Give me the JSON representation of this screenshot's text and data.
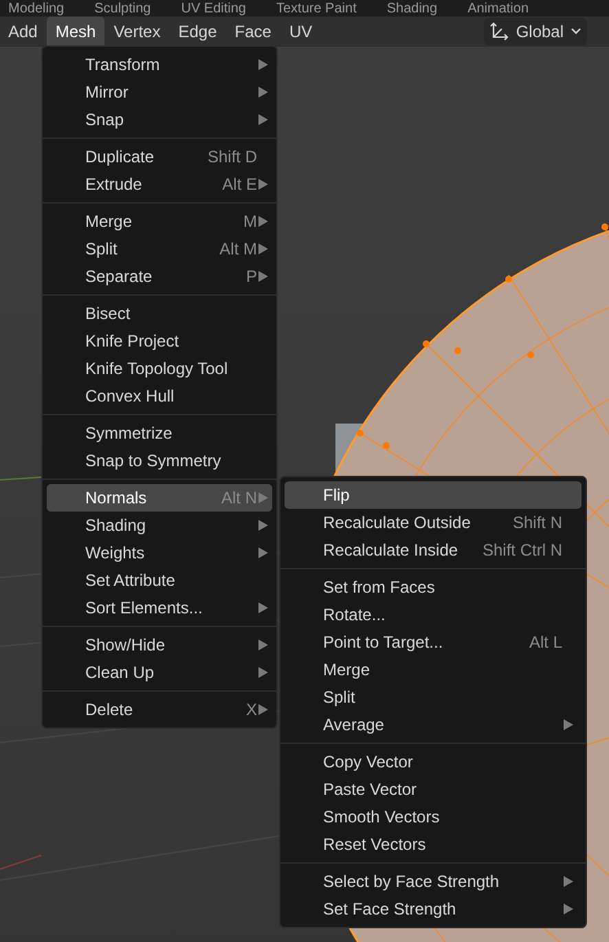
{
  "workspace_tabs": [
    "Modeling",
    "Sculpting",
    "UV Editing",
    "Texture Paint",
    "Shading",
    "Animation"
  ],
  "header_menus": [
    {
      "label": "Add",
      "selected": false
    },
    {
      "label": "Mesh",
      "selected": true
    },
    {
      "label": "Vertex",
      "selected": false
    },
    {
      "label": "Edge",
      "selected": false
    },
    {
      "label": "Face",
      "selected": false
    },
    {
      "label": "UV",
      "selected": false
    }
  ],
  "orientation_dropdown": {
    "value": "Global"
  },
  "mesh_menu": {
    "sections": [
      [
        {
          "label": "Transform",
          "submenu": true,
          "selected": false
        },
        {
          "label": "Mirror",
          "submenu": true,
          "selected": false
        },
        {
          "label": "Snap",
          "submenu": true,
          "selected": false
        }
      ],
      [
        {
          "label": "Duplicate",
          "shortcut": "Shift D",
          "submenu": false,
          "selected": false
        },
        {
          "label": "Extrude",
          "shortcut": "Alt E",
          "submenu": true,
          "selected": false
        }
      ],
      [
        {
          "label": "Merge",
          "shortcut": "M",
          "submenu": true,
          "selected": false
        },
        {
          "label": "Split",
          "shortcut": "Alt M",
          "submenu": true,
          "selected": false
        },
        {
          "label": "Separate",
          "shortcut": "P",
          "submenu": true,
          "selected": false
        }
      ],
      [
        {
          "label": "Bisect",
          "submenu": false,
          "selected": false
        },
        {
          "label": "Knife Project",
          "submenu": false,
          "selected": false
        },
        {
          "label": "Knife Topology Tool",
          "submenu": false,
          "selected": false
        },
        {
          "label": "Convex Hull",
          "submenu": false,
          "selected": false
        }
      ],
      [
        {
          "label": "Symmetrize",
          "submenu": false,
          "selected": false
        },
        {
          "label": "Snap to Symmetry",
          "submenu": false,
          "selected": false
        }
      ],
      [
        {
          "label": "Normals",
          "shortcut": "Alt N",
          "submenu": true,
          "selected": true
        },
        {
          "label": "Shading",
          "submenu": true,
          "selected": false
        },
        {
          "label": "Weights",
          "submenu": true,
          "selected": false
        },
        {
          "label": "Set Attribute",
          "submenu": false,
          "selected": false
        },
        {
          "label": "Sort Elements...",
          "submenu": true,
          "selected": false
        }
      ],
      [
        {
          "label": "Show/Hide",
          "submenu": true,
          "selected": false
        },
        {
          "label": "Clean Up",
          "submenu": true,
          "selected": false
        }
      ],
      [
        {
          "label": "Delete",
          "shortcut": "X",
          "submenu": true,
          "selected": false
        }
      ]
    ]
  },
  "normals_submenu": {
    "sections": [
      [
        {
          "label": "Flip",
          "submenu": false,
          "selected": true
        },
        {
          "label": "Recalculate Outside",
          "shortcut": "Shift N",
          "submenu": false,
          "selected": false
        },
        {
          "label": "Recalculate Inside",
          "shortcut": "Shift Ctrl N",
          "submenu": false,
          "selected": false
        }
      ],
      [
        {
          "label": "Set from Faces",
          "submenu": false,
          "selected": false
        },
        {
          "label": "Rotate...",
          "submenu": false,
          "selected": false
        },
        {
          "label": "Point to Target...",
          "shortcut": "Alt L",
          "submenu": false,
          "selected": false
        },
        {
          "label": "Merge",
          "submenu": false,
          "selected": false
        },
        {
          "label": "Split",
          "submenu": false,
          "selected": false
        },
        {
          "label": "Average",
          "submenu": true,
          "selected": false
        }
      ],
      [
        {
          "label": "Copy Vector",
          "submenu": false,
          "selected": false
        },
        {
          "label": "Paste Vector",
          "submenu": false,
          "selected": false
        },
        {
          "label": "Smooth Vectors",
          "submenu": false,
          "selected": false
        },
        {
          "label": "Reset Vectors",
          "submenu": false,
          "selected": false
        }
      ],
      [
        {
          "label": "Select by Face Strength",
          "submenu": true,
          "selected": false
        },
        {
          "label": "Set Face Strength",
          "submenu": true,
          "selected": false
        }
      ]
    ]
  }
}
